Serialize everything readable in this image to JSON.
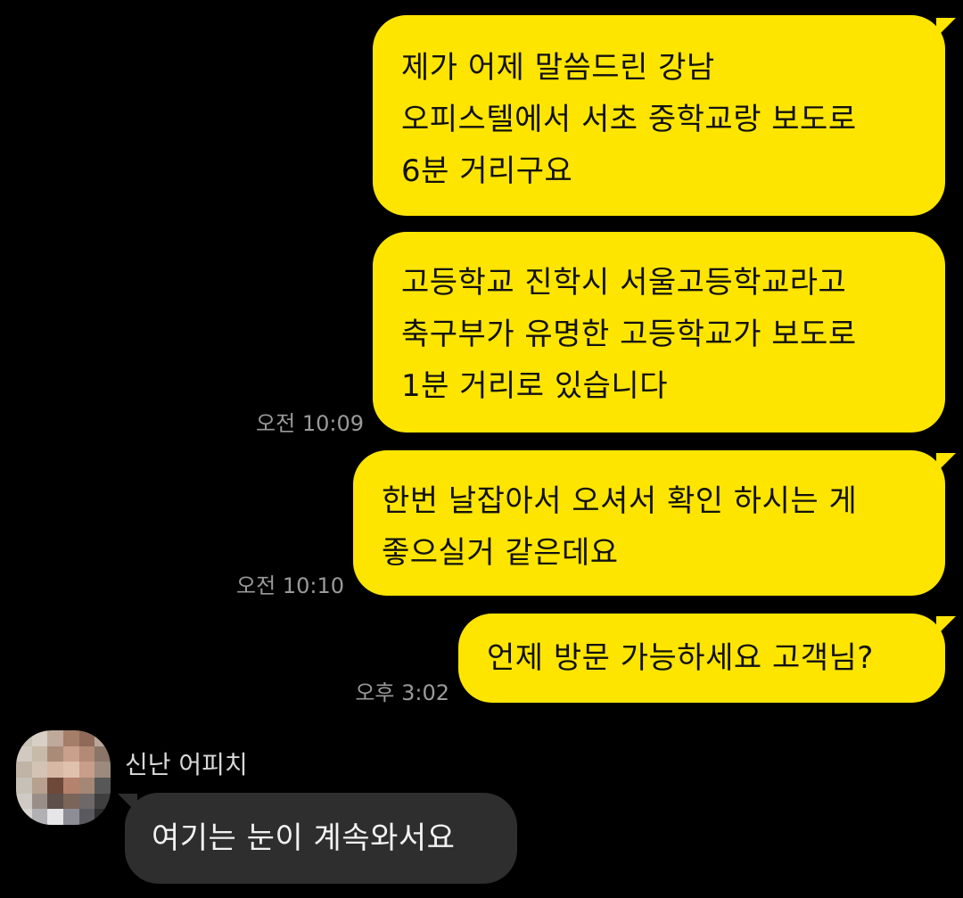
{
  "messages": [
    {
      "direction": "outgoing",
      "lines": [
        "제가 어제 말씀드린 강남",
        "오피스텔에서 서초 중학교랑 보도로",
        "6분 거리구요"
      ],
      "time": ""
    },
    {
      "direction": "outgoing",
      "lines": [
        "고등학교 진학시 서울고등학교라고",
        "축구부가 유명한 고등학교가 보도로",
        "1분 거리로 있습니다"
      ],
      "time": "오전 10:09"
    },
    {
      "direction": "outgoing",
      "lines": [
        "한번 날잡아서 오셔서 확인 하시는 게",
        "좋으실거 같은데요"
      ],
      "time": "오전 10:10"
    },
    {
      "direction": "outgoing",
      "lines": [
        "언제 방문 가능하세요 고객님?"
      ],
      "time": "오후 3:02"
    },
    {
      "direction": "incoming",
      "sender": "신난 어피치",
      "lines": [
        "여기는 눈이 계속와서요"
      ],
      "time": ""
    }
  ],
  "colors": {
    "background": "#000000",
    "outgoing_bubble": "#FEE500",
    "incoming_bubble": "#2E2E2E",
    "timestamp": "#9A9A9A"
  },
  "avatar": {
    "icon": "pixelated-profile-avatar-icon"
  }
}
